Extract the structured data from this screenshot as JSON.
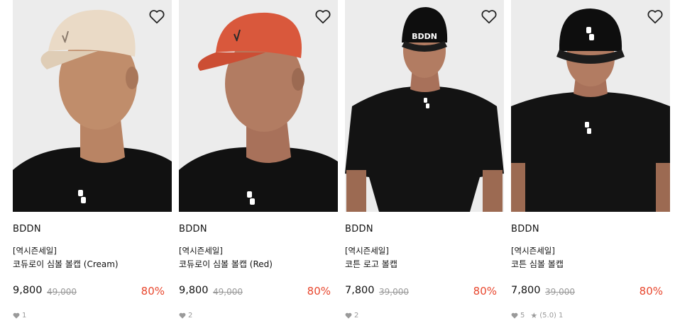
{
  "colors": {
    "accent_discount": "#e8472e",
    "text_primary": "#111111",
    "text_muted": "#999999"
  },
  "products": [
    {
      "brand": "BDDN",
      "tag": "[역시즌세일]",
      "name": "코듀로이 심볼 볼캡 (Cream)",
      "price": "9,800",
      "original_price": "49,000",
      "discount": "80%",
      "likes": "1",
      "image_icon": "model-cream-corduroy-cap"
    },
    {
      "brand": "BDDN",
      "tag": "[역시즌세일]",
      "name": "코듀로이 심볼 볼캡 (Red)",
      "price": "9,800",
      "original_price": "49,000",
      "discount": "80%",
      "likes": "2",
      "image_icon": "model-red-corduroy-cap"
    },
    {
      "brand": "BDDN",
      "tag": "[역시즌세일]",
      "name": "코튼 로고 볼캡",
      "price": "7,800",
      "original_price": "39,000",
      "discount": "80%",
      "likes": "2",
      "image_icon": "model-black-logo-cap",
      "cap_logo": "BDDN"
    },
    {
      "brand": "BDDN",
      "tag": "[역시즌세일]",
      "name": "코튼 심볼 볼캡",
      "price": "7,800",
      "original_price": "39,000",
      "discount": "80%",
      "likes": "5",
      "rating": "(5.0)",
      "reviews": "1",
      "image_icon": "model-black-symbol-cap"
    }
  ]
}
